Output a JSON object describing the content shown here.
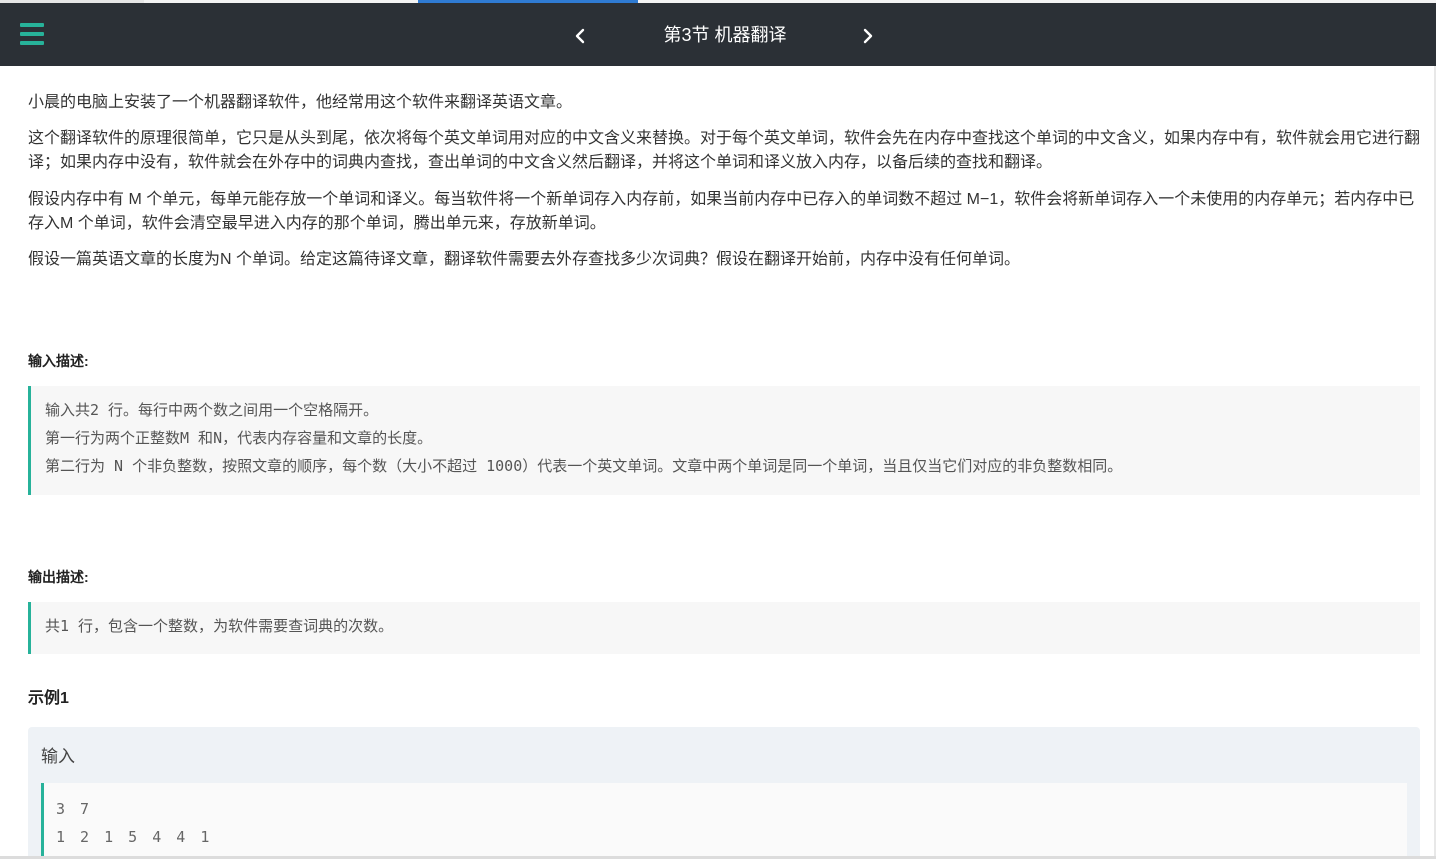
{
  "header": {
    "title": "第3节 机器翻译",
    "prev_glyph": "‹",
    "next_glyph": "›",
    "menu_icon": "hamburger-menu-icon",
    "accent_color": "#27b29a",
    "background_color": "#2b3036"
  },
  "problem": {
    "paragraphs": [
      "小晨的电脑上安装了一个机器翻译软件，他经常用这个软件来翻译英语文章。",
      "这个翻译软件的原理很简单，它只是从头到尾，依次将每个英文单词用对应的中文含义来替换。对于每个英文单词，软件会先在内存中查找这个单词的中文含义，如果内存中有，软件就会用它进行翻译；如果内存中没有，软件就会在外存中的词典内查找，查出单词的中文含义然后翻译，并将这个单词和译义放入内存，以备后续的查找和翻译。",
      "假设内存中有 M 个单元，每单元能存放一个单词和译义。每当软件将一个新单词存入内存前，如果当前内存中已存入的单词数不超过 M−1，软件会将新单词存入一个未使用的内存单元；若内存中已存入M 个单词，软件会清空最早进入内存的那个单词，腾出单元来，存放新单词。",
      "假设一篇英语文章的长度为N 个单词。给定这篇待译文章，翻译软件需要去外存查找多少次词典？假设在翻译开始前，内存中没有任何单词。"
    ]
  },
  "input_section": {
    "title": "输入描述:",
    "lines": [
      "输入共2 行。每行中两个数之间用一个空格隔开。",
      "第一行为两个正整数M 和N，代表内存容量和文章的长度。",
      "第二行为 N 个非负整数，按照文章的顺序，每个数（大小不超过 1000）代表一个英文单词。文章中两个单词是同一个单词，当且仅当它们对应的非负整数相同。"
    ]
  },
  "output_section": {
    "title": "输出描述:",
    "lines": [
      "共1 行，包含一个整数，为软件需要查词典的次数。"
    ]
  },
  "example": {
    "title": "示例1",
    "input_label": "输入",
    "input_lines": [
      "3 7",
      "1 2 1 5 4 4 1"
    ]
  }
}
